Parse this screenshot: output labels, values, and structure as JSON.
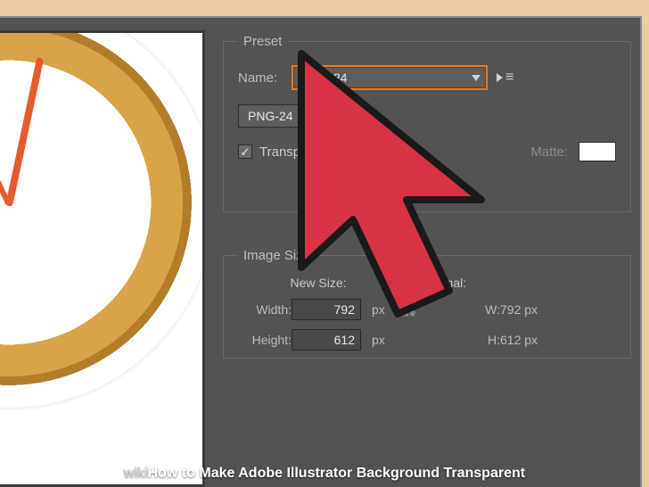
{
  "preset": {
    "legend": "Preset",
    "name_label": "Name:",
    "name_value": "PNG-24",
    "format_value": "PNG-24",
    "transparency_checked": true,
    "transparency_label": "Transparency",
    "matte_label": "Matte:"
  },
  "image_size": {
    "legend": "Image Size",
    "new_size_label": "New Size:",
    "original_label": "Original:",
    "width_label": "Width:",
    "width_value": "792",
    "height_label": "Height:",
    "height_value": "612",
    "unit": "px",
    "orig_w_label": "W:",
    "orig_w_value": "792 px",
    "orig_h_label": "H:",
    "orig_h_value": "612 px"
  },
  "watermark": {
    "prefix": "wiki",
    "how": "How",
    "rest": " to Make Adobe Illustrator Background Transparent"
  },
  "colors": {
    "panel_bg": "#535353",
    "accent_orange": "#e07a2a",
    "cursor_red": "#d63344"
  }
}
